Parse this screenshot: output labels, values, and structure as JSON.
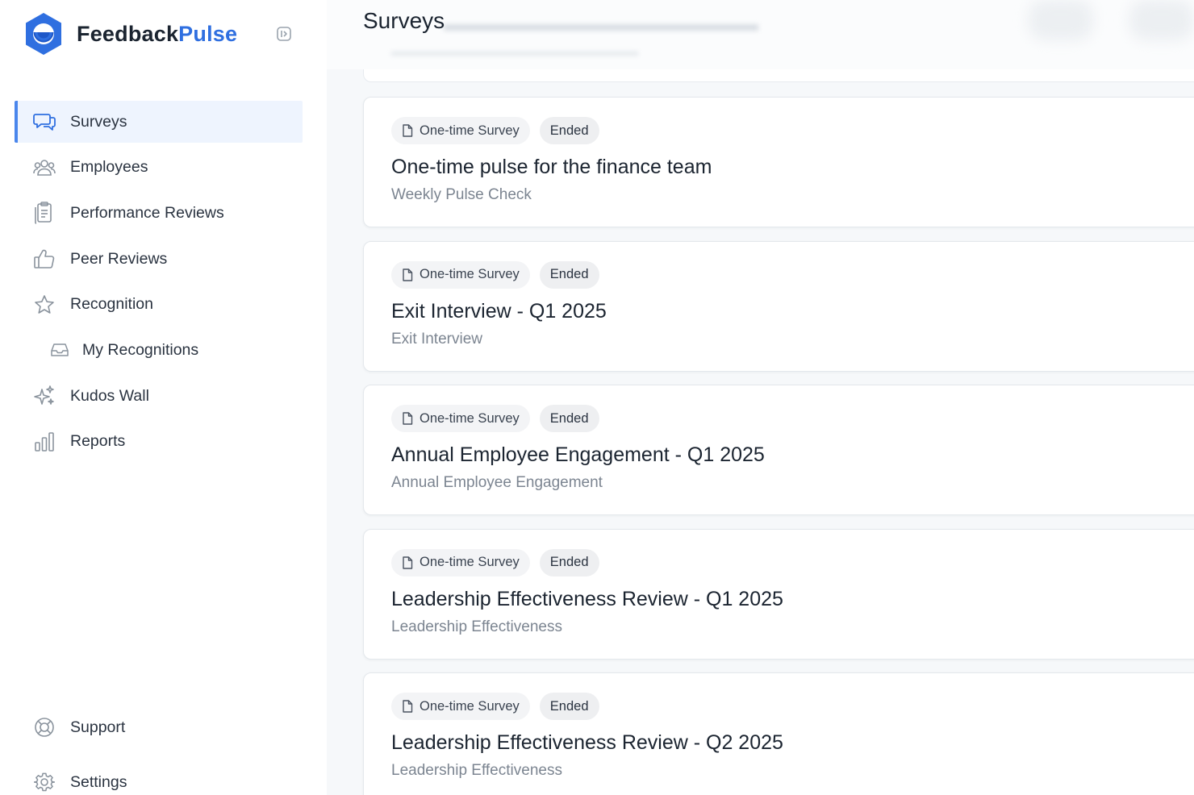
{
  "app": {
    "name_part1": "Feedback",
    "name_part2": "Pulse",
    "brand_color": "#2f6fe0"
  },
  "sidebar": {
    "items": [
      {
        "label": "Surveys",
        "icon": "chat-bubbles-icon",
        "active": true
      },
      {
        "label": "Employees",
        "icon": "users-icon"
      },
      {
        "label": "Performance Reviews",
        "icon": "clipboard-icon"
      },
      {
        "label": "Peer Reviews",
        "icon": "thumbs-up-icon"
      },
      {
        "label": "Recognition",
        "icon": "star-icon"
      },
      {
        "label": "My Recognitions",
        "icon": "inbox-icon",
        "sub": true
      },
      {
        "label": "Kudos Wall",
        "icon": "sparkles-icon"
      },
      {
        "label": "Reports",
        "icon": "bar-chart-icon"
      }
    ],
    "bottom_items": [
      {
        "label": "Support",
        "icon": "lifebuoy-icon"
      },
      {
        "label": "Settings",
        "icon": "gear-icon"
      }
    ]
  },
  "main": {
    "title": "Surveys",
    "cards": [
      {
        "type": "One-time Survey",
        "status": "Ended",
        "title": "One-time pulse for the finance team",
        "subtitle": "Weekly Pulse Check"
      },
      {
        "type": "One-time Survey",
        "status": "Ended",
        "title": "Exit Interview - Q1 2025",
        "subtitle": "Exit Interview"
      },
      {
        "type": "One-time Survey",
        "status": "Ended",
        "title": "Annual Employee Engagement - Q1 2025",
        "subtitle": "Annual Employee Engagement"
      },
      {
        "type": "One-time Survey",
        "status": "Ended",
        "title": "Leadership Effectiveness Review - Q1 2025",
        "subtitle": "Leadership Effectiveness"
      },
      {
        "type": "One-time Survey",
        "status": "Ended",
        "title": "Leadership Effectiveness Review - Q2 2025",
        "subtitle": "Leadership Effectiveness"
      }
    ]
  },
  "colors": {
    "active_bg": "#eef4fe",
    "active_border": "#4a86ec",
    "badge_bg": "#f3f4f6",
    "main_bg": "#f6f8fa"
  }
}
